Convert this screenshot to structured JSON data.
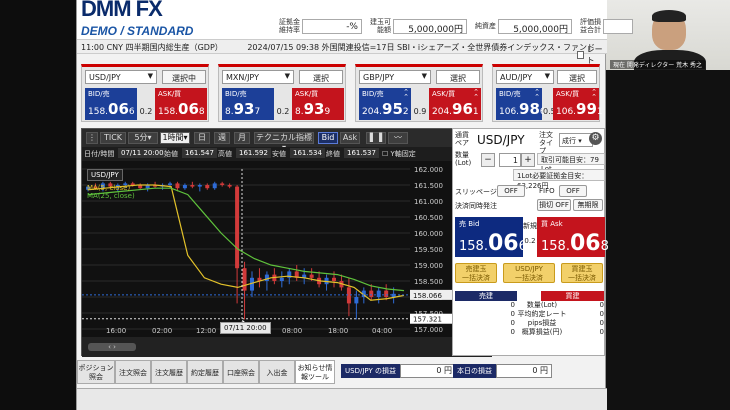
{
  "header": {
    "logo": "DMM FX",
    "logo_sub": "DEMO / STANDARD",
    "stats": [
      {
        "label": "証拠金維持率",
        "value": "-%"
      },
      {
        "label": "建玉可能額",
        "value": "5,000,000円"
      },
      {
        "label": "純資産",
        "value": "5,000,000円"
      },
      {
        "label": "評価損益合計",
        "value": ""
      }
    ],
    "rate_checkbox": "レート"
  },
  "ticker": [
    "11:00 CNY 四半期国内総生産（GDP）",
    "2024/07/15 09:38 外国関連投信=17日 SBI・iシェアーズ・全世界債券インデックス・ファンド"
  ],
  "panels": [
    {
      "pair": "USD/JPY",
      "button": "選択中",
      "bid_label": "BID/売",
      "ask_label": "ASK/買",
      "bid_main": "158.",
      "bid_big": "06",
      "bid_small": "6",
      "ask_main": "158.",
      "ask_big": "06",
      "ask_small": "8",
      "spread": "0.2"
    },
    {
      "pair": "MXN/JPY",
      "button": "選択",
      "bid_label": "BID/売",
      "ask_label": "ASK/買",
      "bid_main": "8.",
      "bid_big": "93",
      "bid_small": "7",
      "ask_main": "8.",
      "ask_big": "93",
      "ask_small": "9",
      "spread": "0.2"
    },
    {
      "pair": "GBP/JPY",
      "button": "選択",
      "bid_label": "BID/売",
      "ask_label": "ASK/買",
      "bid_main": "204.",
      "bid_big": "95",
      "bid_small": "2",
      "ask_main": "204.",
      "ask_big": "96",
      "ask_small": "1",
      "spread": "0.9"
    },
    {
      "pair": "AUD/JPY",
      "button": "選択",
      "bid_label": "BID/売",
      "ask_label": "ASK/買",
      "bid_main": "106.",
      "bid_big": "98",
      "bid_small": "6",
      "ask_main": "106.",
      "ask_big": "99",
      "ask_small": "1",
      "spread": "0.5"
    }
  ],
  "chart": {
    "toolbar": {
      "tick": "TICK",
      "interval": "5分",
      "period": "1時間",
      "day": "日",
      "week": "週",
      "month": "月",
      "tech": "テクニカル指標",
      "bid": "Bid",
      "ask": "Ask"
    },
    "info": {
      "datetime_label": "日付/時間",
      "datetime": "07/11 20:00",
      "open_label": "始値",
      "open": "161.547",
      "high_label": "高値",
      "high": "161.592",
      "low_label": "安値",
      "low": "161.534",
      "close_label": "終値",
      "close": "161.537",
      "yaxis_label": "Y軸固定"
    },
    "legend_pair": "USD/JPY",
    "ma5": "MA(5, close)",
    "ma25": "MA(25, close)",
    "y_ticks": [
      "162.000",
      "161.500",
      "161.000",
      "160.500",
      "160.000",
      "159.500",
      "159.000",
      "158.500",
      "158.000",
      "157.500",
      "157.000"
    ],
    "x_ticks": [
      "16:00",
      "02:00",
      "12:00",
      "08:00",
      "18:00",
      "04:00"
    ],
    "price_tag": "158.066",
    "cursor_price": "157.321",
    "time_tip": "07/11 20:00"
  },
  "chart_data": {
    "type": "line",
    "title": "USD/JPY",
    "series": [
      {
        "name": "MA(5, close)",
        "color": "#e3c22a",
        "values": [
          161.35,
          161.4,
          161.45,
          161.5,
          161.5,
          161.45,
          159.3,
          158.6,
          158.4,
          158.3,
          158.45,
          158.6,
          158.65,
          158.6,
          158.5,
          158.45,
          158.3,
          157.9,
          157.95,
          158.05
        ]
      },
      {
        "name": "MA(25, close)",
        "color": "#5fc23c",
        "values": [
          161.2,
          161.25,
          161.3,
          161.35,
          161.4,
          161.4,
          161.2,
          160.6,
          160.0,
          159.5,
          159.2,
          159.0,
          158.9,
          158.8,
          158.75,
          158.7,
          158.55,
          158.35,
          158.25,
          158.2
        ]
      }
    ],
    "ylim": [
      157.0,
      162.0
    ]
  },
  "order": {
    "pair_label": "通貨ペア",
    "pair": "USD/JPY",
    "type_label": "注文タイプ",
    "type": "成行",
    "qty_label": "数量(Lot)",
    "minus": "−",
    "plus": "+",
    "qty": "1",
    "max_order": "取引可能目安：79 Lot",
    "margin": "1Lot必要証拠金目安：63,226円",
    "slippage_label": "スリッページ",
    "slippage": "OFF",
    "fifo_label": "FIFO",
    "fifo": "OFF",
    "settle_label": "決済同時発注",
    "settle_a": "損切 OFF",
    "settle_b": "無期限",
    "bid_label": "売 Bid",
    "ask_label": "買 Ask",
    "new_label": "新規",
    "bid_main": "158.",
    "bid_big": "06",
    "bid_small": "6",
    "ask_main": "158.",
    "ask_big": "06",
    "ask_small": "8",
    "spread": "0.2",
    "btn_sell": "売建玉\n一括決済",
    "btn_all": "USD/JPY\n一括決済",
    "btn_buy": "買建玉\n一括決済",
    "tbl_sell": "売建",
    "tbl_buy": "買建",
    "rows": [
      {
        "label": "数量(Lot)",
        "sell": "0",
        "buy": "0"
      },
      {
        "label": "平均約定レート",
        "sell": "0",
        "buy": "0"
      },
      {
        "label": "pips損益",
        "sell": "0",
        "buy": "0"
      },
      {
        "label": "概算損益(円)",
        "sell": "0",
        "buy": "0"
      }
    ]
  },
  "bottom": {
    "tabs": [
      "ポジション照会",
      "注文照会",
      "注文履歴",
      "約定履歴",
      "口座照会",
      "入出金",
      "お知らせ情報ツール"
    ],
    "pl_pair_label": "USD/JPY の損益",
    "pl_pair_value": "0 円",
    "pl_today_label": "本日の損益",
    "pl_today_value": "0 円"
  },
  "cam": {
    "caption": "現在 開発ディレクター 荒木 秀之"
  }
}
